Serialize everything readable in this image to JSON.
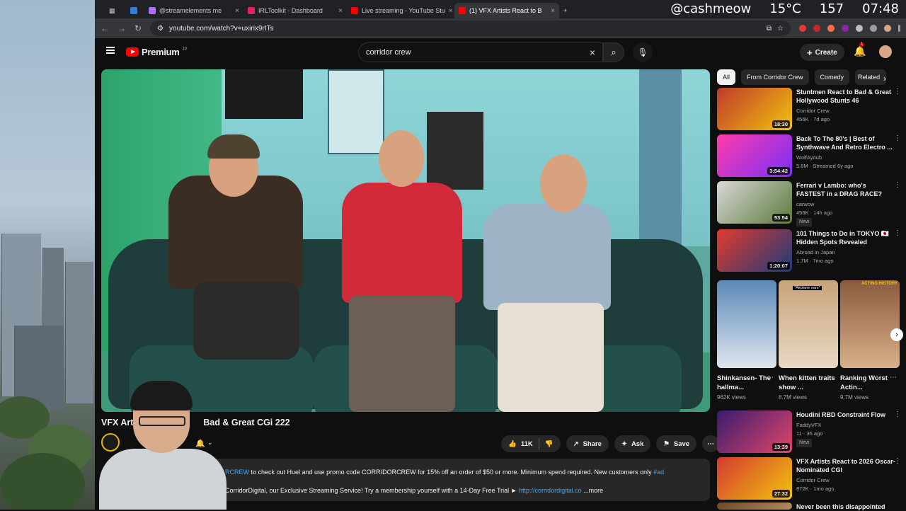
{
  "hud": {
    "handle": "@cashmeow",
    "temp": "15°C",
    "count": "157",
    "time": "07:48"
  },
  "tabs": [
    {
      "label": "@streamelements me",
      "color": "#a970ff"
    },
    {
      "label": "IRLToolkit - Dashboard",
      "color": "#e0245e"
    },
    {
      "label": "Live streaming - YouTube Stu",
      "color": "#ff0000"
    },
    {
      "label": "(1) VFX Artists React to B",
      "color": "#ff0000"
    }
  ],
  "address": {
    "url": "youtube.com/watch?v=uxirix9rITs"
  },
  "header": {
    "logo": "Premium",
    "region": "JP",
    "search_value": "corridor crew",
    "create": "Create",
    "bell_badge": "1"
  },
  "video": {
    "title_left": "VFX Arti",
    "title_right": "Bad & Great CGi 222",
    "likes": "11K",
    "share": "Share",
    "ask": "Ask",
    "save": "Save",
    "desc_line1_link": "RCREW",
    "desc_line1": " to check out Huel and use promo code CORRIDORCREW for 15% off an order of $50 or more. Minimum spend required. New customers only ",
    "desc_line1_tag": "#ad",
    "desc_line2": "CorridorDigital, our Exclusive Streaming Service! Try a membership yourself with a 14-Day Free Trial ► ",
    "desc_line2_link": "http://corridordigital.co",
    "desc_more": " ...more"
  },
  "chips": [
    "All",
    "From Corridor Crew",
    "Comedy",
    "Related"
  ],
  "recs": [
    {
      "title": "Stuntmen React to Bad & Great Hollywood Stunts 46",
      "channel": "Corridor Crew",
      "meta": "456K · 7d ago",
      "duration": "18:30",
      "c1": "#c0392b",
      "c2": "#f1c40f"
    },
    {
      "title": "Back To The 80's | Best of Synthwave And Retro Electro ...",
      "channel": "WolfAyoub",
      "meta": "5.8M · Streamed 6y ago",
      "duration": "3:54:42",
      "c1": "#ff3cac",
      "c2": "#7b2ff7"
    },
    {
      "title": "Ferrari v Lambo: who's FASTEST in a DRAG RACE?",
      "channel": "carwow",
      "meta": "456K · 14h ago",
      "duration": "53:54",
      "badge": "New",
      "c1": "#d8d8d8",
      "c2": "#5c7a3a"
    },
    {
      "title": "101 Things to Do in TOKYO 🇯🇵 Hidden Spots Revealed",
      "channel": "Abroad in Japan",
      "meta": "1.7M · 7mo ago",
      "duration": "1:20:07",
      "c1": "#e23b2e",
      "c2": "#1d3b78"
    }
  ],
  "shorts": [
    {
      "title": "Shinkansen- The hallma...",
      "views": "962K views",
      "c1": "#5d88b8",
      "c2": "#dde6ee"
    },
    {
      "title": "When kitten traits show ...",
      "views": "8.7M views",
      "c1": "#c9a37a",
      "c2": "#e8d9c4",
      "label": "*Airplane ears*"
    },
    {
      "title": "Ranking Worst Actin...",
      "views": "9.7M views",
      "c1": "#8a5a3c",
      "c2": "#d9b08c",
      "label": "ACTING HISTORY"
    }
  ],
  "recs2": [
    {
      "title": "Houdini RBD Constraint Flow",
      "channel": "FaddyVFX",
      "meta": "11 · 3h ago",
      "duration": "13:39",
      "badge": "New",
      "c1": "#3a1c6e",
      "c2": "#e0466a"
    },
    {
      "title": "VFX Artists React to 2026 Oscar-Nominated CGI",
      "channel": "Corridor Crew",
      "meta": "872K · 1mo ago",
      "duration": "27:32",
      "c1": "#d43a2f",
      "c2": "#f1c40f"
    },
    {
      "title": "Never been this disappointed",
      "channel": "",
      "meta": "",
      "duration": "",
      "c1": "#6b4a2e",
      "c2": "#b58b5c"
    }
  ]
}
